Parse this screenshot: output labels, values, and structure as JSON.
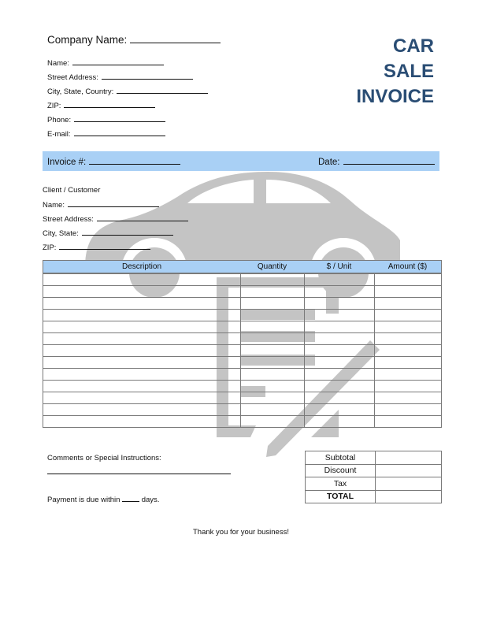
{
  "header": {
    "company_name_label": "Company Name:",
    "title_lines": [
      "CAR",
      "SALE",
      "INVOICE"
    ],
    "title_color": "#2a4d74"
  },
  "seller_fields": [
    {
      "label": "Name:"
    },
    {
      "label": "Street Address:"
    },
    {
      "label": "City, State, Country:"
    },
    {
      "label": "ZIP:"
    },
    {
      "label": "Phone:"
    },
    {
      "label": "E-mail:"
    }
  ],
  "invoice_bar": {
    "invoice_label": "Invoice #:",
    "date_label": "Date:",
    "bar_color": "#a9d0f5"
  },
  "client": {
    "heading": "Client / Customer",
    "fields": [
      {
        "label": "Name:"
      },
      {
        "label": "Street Address:"
      },
      {
        "label": "City, State:"
      },
      {
        "label": "ZIP:"
      }
    ]
  },
  "items_table": {
    "columns": [
      "Description",
      "Quantity",
      "$ / Unit",
      "Amount ($)"
    ],
    "row_count": 13,
    "rows": []
  },
  "footer": {
    "comments_label": "Comments or Special Instructions:",
    "payment_prefix": "Payment is due within",
    "payment_suffix": "days.",
    "totals": [
      {
        "label": "Subtotal",
        "value": ""
      },
      {
        "label": "Discount",
        "value": ""
      },
      {
        "label": "Tax",
        "value": ""
      },
      {
        "label": "TOTAL",
        "value": ""
      }
    ],
    "thanks": "Thank you for your business!"
  },
  "watermark": {
    "icons": [
      "car-icon",
      "document-edit-icon"
    ],
    "color": "#c4c4c4"
  }
}
